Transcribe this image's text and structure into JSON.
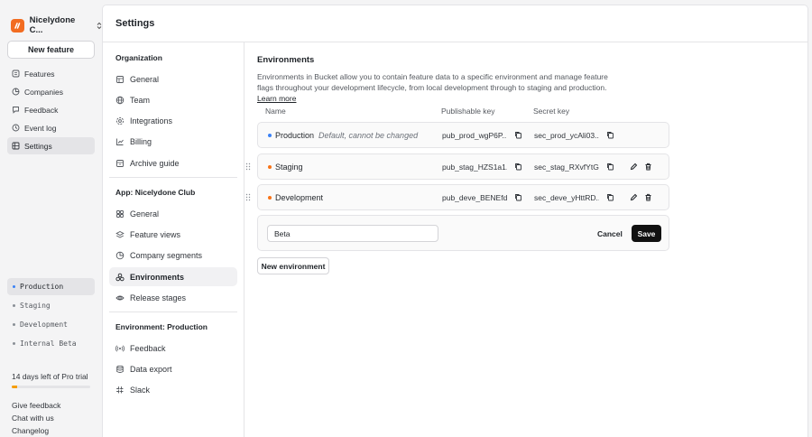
{
  "org": {
    "name": "Nicelydone C...",
    "chevron_icon": "chevron-up-down-icon"
  },
  "sidebar": {
    "new_feature_label": "New feature",
    "nav": [
      {
        "label": "Features",
        "icon": "list-icon"
      },
      {
        "label": "Companies",
        "icon": "pie-icon"
      },
      {
        "label": "Feedback",
        "icon": "chat-icon"
      },
      {
        "label": "Event log",
        "icon": "clock-icon"
      },
      {
        "label": "Settings",
        "icon": "grid-icon",
        "active": true
      }
    ],
    "environments": [
      {
        "label": "Production",
        "active": true
      },
      {
        "label": "Staging"
      },
      {
        "label": "Development"
      },
      {
        "label": "Internal Beta"
      }
    ],
    "trial_text": "14 days left of Pro trial",
    "trial_progress": 0.07,
    "links": [
      "Give feedback",
      "Chat with us",
      "Changelog"
    ]
  },
  "header": {
    "title": "Settings"
  },
  "settings_nav": {
    "org_section": "Organization",
    "org_items": [
      "General",
      "Team",
      "Integrations",
      "Billing",
      "Archive guide"
    ],
    "app_section": "App: Nicelydone Club",
    "app_items": [
      "General",
      "Feature views",
      "Company segments",
      "Environments",
      "Release stages"
    ],
    "env_section": "Environment: Production",
    "env_items": [
      "Feedback",
      "Data export",
      "Slack"
    ]
  },
  "content": {
    "title": "Environments",
    "description": "Environments in Bucket allow you to contain feature data to a specific environment and manage feature flags throughout your development lifecycle, from local development through to staging and production.",
    "learn_more": "Learn more",
    "columns": {
      "name": "Name",
      "publishable": "Publishable key",
      "secret": "Secret key"
    },
    "rows": [
      {
        "name": "Production",
        "note": "Default, cannot be changed",
        "publishable": "pub_prod_wgP6P...",
        "secret": "sec_prod_ycAli03...",
        "color": "#3b82f6"
      },
      {
        "name": "Staging",
        "note": "",
        "publishable": "pub_stag_HZS1a1...",
        "secret": "sec_stag_RXvfYtG...",
        "color": "#f97316"
      },
      {
        "name": "Development",
        "note": "",
        "publishable": "pub_deve_BENEfd...",
        "secret": "sec_deve_yHttRD...",
        "color": "#f97316"
      }
    ],
    "new_input_value": "Beta",
    "cancel_label": "Cancel",
    "save_label": "Save",
    "new_env_label": "New environment"
  }
}
